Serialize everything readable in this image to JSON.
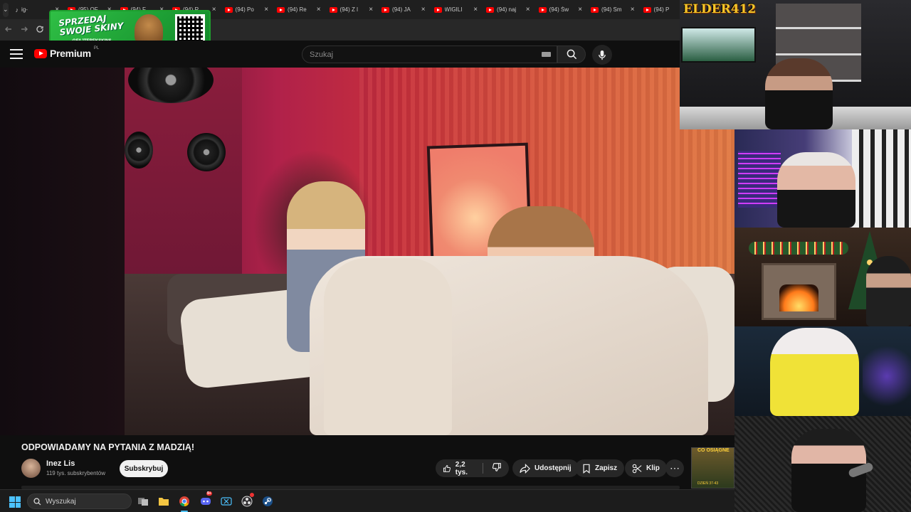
{
  "browser": {
    "tabs": [
      {
        "title": "ig-",
        "kind": "tiktok"
      },
      {
        "title": "(95) OF",
        "kind": "youtube"
      },
      {
        "title": "(94) F",
        "kind": "youtube"
      },
      {
        "title": "(94) R",
        "kind": "youtube"
      },
      {
        "title": "(94) Po",
        "kind": "youtube"
      },
      {
        "title": "(94) Re",
        "kind": "youtube"
      },
      {
        "title": "(94) Z l",
        "kind": "youtube"
      },
      {
        "title": "(94) JA",
        "kind": "youtube"
      },
      {
        "title": "WIGILI",
        "kind": "youtube"
      },
      {
        "title": "(94) naj",
        "kind": "youtube"
      },
      {
        "title": "(94) Św",
        "kind": "youtube"
      },
      {
        "title": "(94) Sm",
        "kind": "youtube"
      },
      {
        "title": "(94) P",
        "kind": "youtube"
      }
    ],
    "close_glyph": "×",
    "menu_glyph": "⌄"
  },
  "promo": {
    "line1": "SPRZEDAJ",
    "line2": "SWOJE SKINY",
    "handle": "@FAJTEREKSKINS"
  },
  "youtube": {
    "wordmark": "Premium",
    "region": "PL",
    "search_placeholder": "Szukaj",
    "brand_red": "#ff0000"
  },
  "video": {
    "title": "ODPOWIADAMY NA PYTANIA Z MADZIĄ!",
    "channel_name": "Inez Lis",
    "channel_subs": "119 tys. subskrybentów",
    "subscribe_label": "Subskrybuj",
    "likes": "2,2 tys.",
    "share_label": "Udostępnij",
    "save_label": "Zapisz",
    "clip_label": "Klip",
    "more_glyph": "⋯"
  },
  "widget": {
    "title": "CO OSIĄGNE",
    "footer": "DZIEŃ 37-43"
  },
  "overlay": {
    "elder_logo": "ELDER412"
  },
  "taskbar": {
    "search_placeholder": "Wyszukaj",
    "accent": "#4cc2ff",
    "apps": [
      "task-view-icon",
      "file-explorer-icon",
      "chrome-icon",
      "discord-icon",
      "xbox-app-icon",
      "obs-icon",
      "steam-icon"
    ],
    "discord_badge": "9+"
  }
}
